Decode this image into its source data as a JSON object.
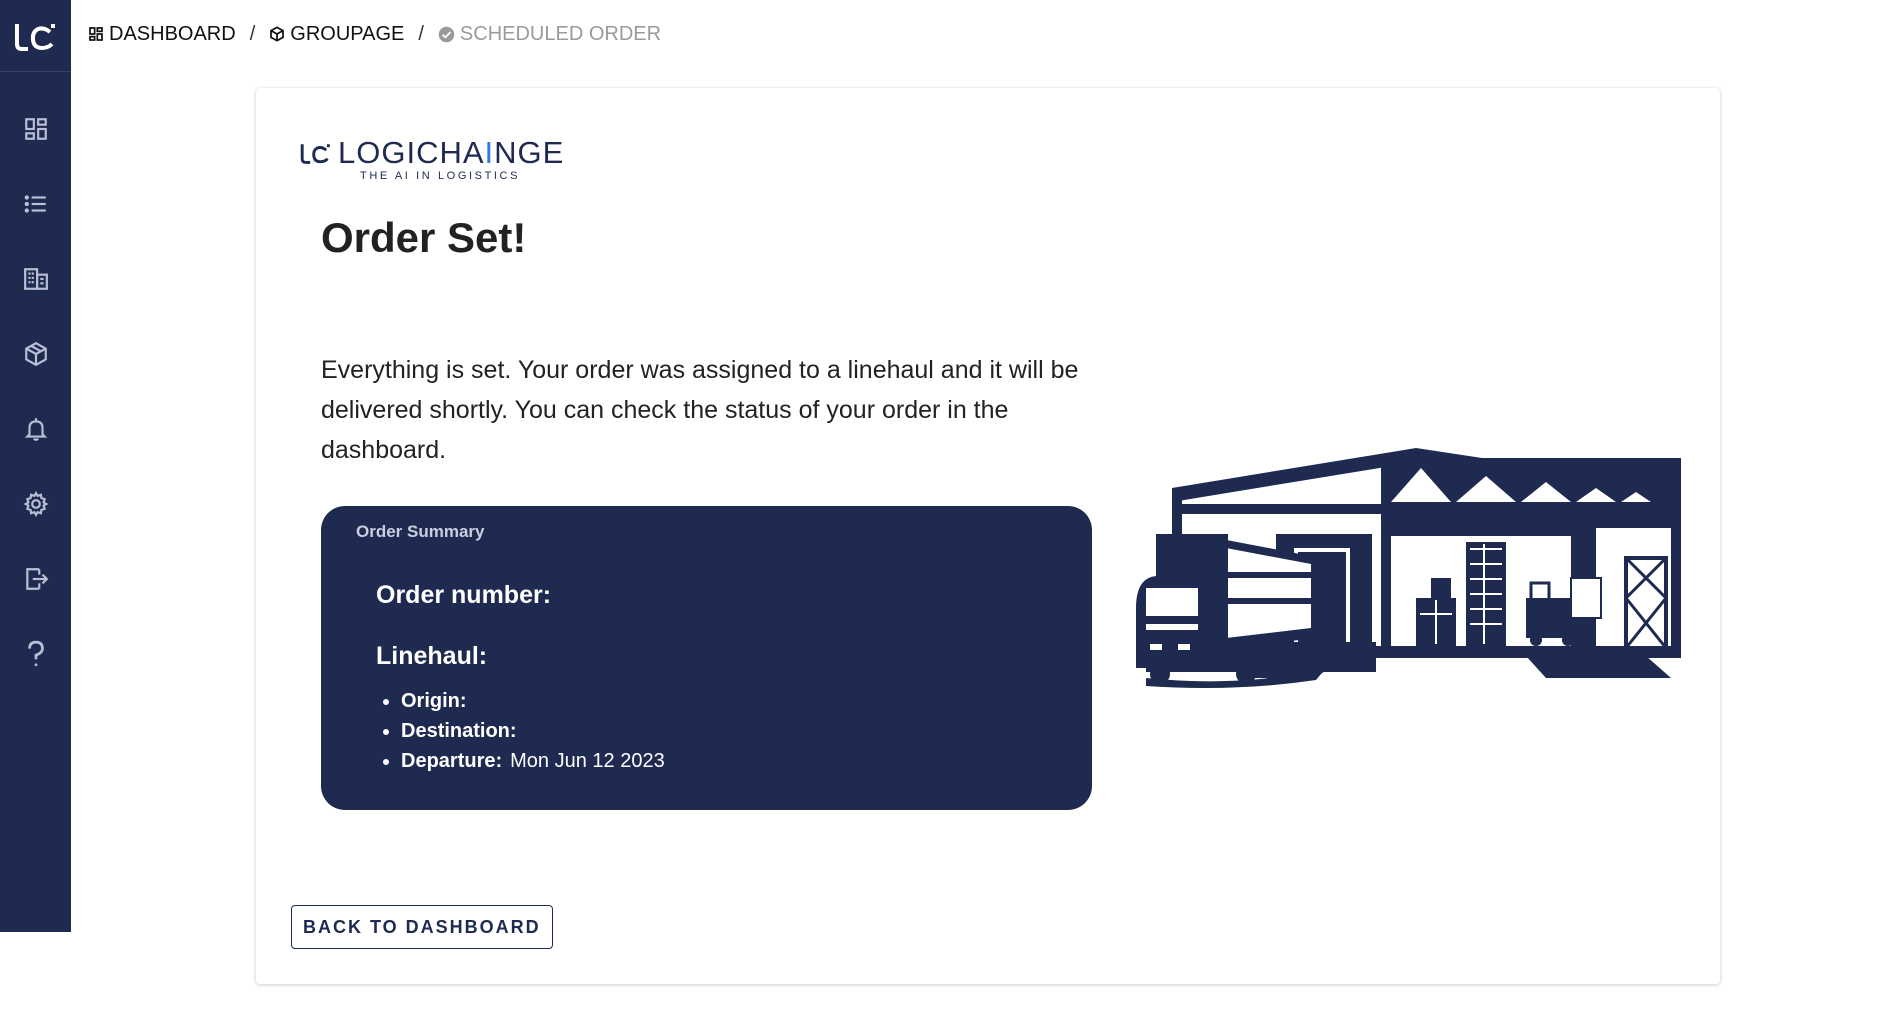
{
  "brand": {
    "name_prefix": "LOGICHA",
    "name_ai": "I",
    "name_suffix": "NGE",
    "tagline": "THE AI IN LOGISTICS"
  },
  "breadcrumb": {
    "items": [
      {
        "label": "DASHBOARD",
        "icon": "dashboard-icon"
      },
      {
        "label": "GROUPAGE",
        "icon": "package-icon"
      },
      {
        "label": "SCHEDULED ORDER",
        "icon": "check-circle-icon"
      }
    ],
    "separator": "/"
  },
  "sidebar": {
    "items": [
      {
        "icon": "dashboard-icon"
      },
      {
        "icon": "list-icon"
      },
      {
        "icon": "warehouse-icon"
      },
      {
        "icon": "package-icon"
      },
      {
        "icon": "bell-icon"
      },
      {
        "icon": "gear-icon"
      },
      {
        "icon": "logout-icon"
      },
      {
        "icon": "help-icon"
      }
    ]
  },
  "main": {
    "title": "Order Set!",
    "message": "Everything is set. Your order was assigned to a linehaul and it will be delivered shortly. You can check the status of your order in the dashboard.",
    "summary": {
      "label": "Order Summary",
      "order_number_label": "Order number:",
      "linehaul_label": "Linehaul:",
      "origin_label": "Origin:",
      "destination_label": "Destination:",
      "departure_label": "Departure:",
      "departure_value": "Mon Jun 12 2023"
    },
    "back_button": "BACK TO DASHBOARD"
  },
  "colors": {
    "navy": "#1e2a4f",
    "accent": "#2a7be4",
    "muted": "#9a9a9a"
  }
}
